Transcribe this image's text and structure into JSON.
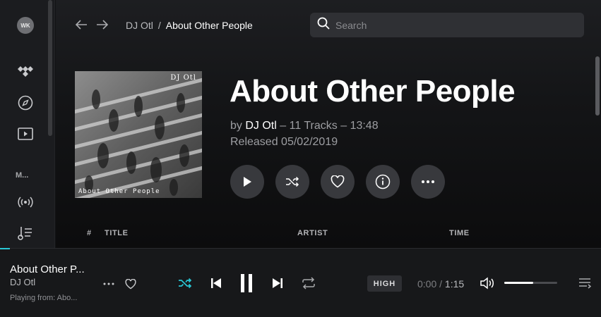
{
  "user": {
    "initials": "WK"
  },
  "sidebar": {
    "my_label": "M..."
  },
  "breadcrumb": {
    "parent": "DJ Otl",
    "separator": "/",
    "current": "About Other People"
  },
  "search": {
    "placeholder": "Search"
  },
  "album": {
    "title": "About Other People",
    "by_prefix": "by",
    "artist": "DJ Otl",
    "details": " – 11 Tracks – 13:48",
    "released": "Released 05/02/2019",
    "cover_artist_text": "DJ Otl",
    "cover_album_text": "About Other People"
  },
  "table": {
    "headers": {
      "num": "#",
      "title": "TITLE",
      "artist": "ARTIST",
      "time": "TIME"
    }
  },
  "player": {
    "title": "About Other P...",
    "artist": "DJ Otl",
    "playing_from": "Playing from:  Abo...",
    "quality": "HIGH",
    "elapsed": "0:00",
    "separator": "/",
    "duration": "1:15",
    "volume_level": 0.55,
    "progress_fraction": 0.0
  },
  "colors": {
    "accent": "#29c7d5",
    "background": "#111214",
    "button": "#38393d"
  }
}
